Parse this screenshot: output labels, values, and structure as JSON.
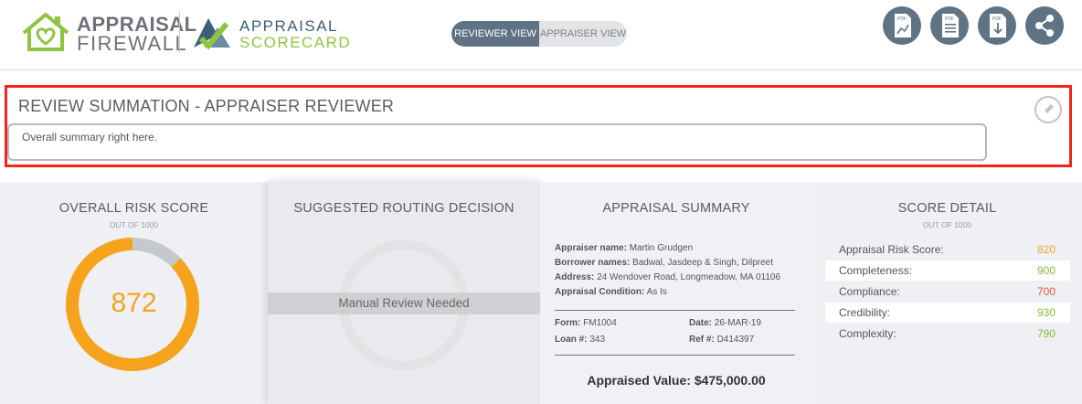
{
  "header": {
    "logo1_line1": "APPRAISAL",
    "logo1_line2": "FIREWALL",
    "logo2_line1": "APPRAISAL",
    "logo2_line2": "SCORECARD",
    "toggle": {
      "active": "REVIEWER VIEW",
      "inactive": "APPRAISER VIEW"
    },
    "icons": [
      "pdf-chart-icon",
      "pdf-document-icon",
      "pdf-download-icon",
      "share-icon"
    ],
    "pdf_label": "PDF"
  },
  "review": {
    "title": "REVIEW SUMMATION - APPRAISER REVIEWER",
    "summary_text": "Overall summary right here."
  },
  "risk": {
    "title": "OVERALL RISK SCORE",
    "subtitle": "OUT OF 1000",
    "score": "872",
    "score_value": 872,
    "score_max": 1000,
    "ring_color": "#f6a31c",
    "track_color": "#c5c9cc"
  },
  "routing": {
    "title": "SUGGESTED ROUTING DECISION",
    "decision": "Manual Review Needed"
  },
  "appraisal": {
    "title": "APPRAISAL SUMMARY",
    "appraiser_label": "Appraiser name:",
    "appraiser": "Martin Grudgen",
    "borrower_label": "Borrower names:",
    "borrower": "Badwal, Jasdeep & Singh, Dilpreet",
    "address_label": "Address:",
    "address": "24 Wendover Road, Longmeadow, MA 01106",
    "condition_label": "Appraisal Condition:",
    "condition": "As Is",
    "form_label": "Form:",
    "form": "FM1004",
    "date_label": "Date:",
    "date": "26-MAR-19",
    "loan_label": "Loan #:",
    "loan": "343",
    "ref_label": "Ref #:",
    "ref": "D414397",
    "value_label": "Appraised Value:",
    "value": "$475,000.00"
  },
  "score_detail": {
    "title": "SCORE DETAIL",
    "subtitle": "OUT OF 1000",
    "rows": [
      {
        "label": "Appraisal Risk Score:",
        "value": "820",
        "color": "#f6a31c"
      },
      {
        "label": "Completeness:",
        "value": "900",
        "color": "#8cb83a"
      },
      {
        "label": "Compliance:",
        "value": "700",
        "color": "#e8553e"
      },
      {
        "label": "Credibility:",
        "value": "930",
        "color": "#8cb83a"
      },
      {
        "label": "Complexity:",
        "value": "790",
        "color": "#8cb83a"
      }
    ]
  }
}
